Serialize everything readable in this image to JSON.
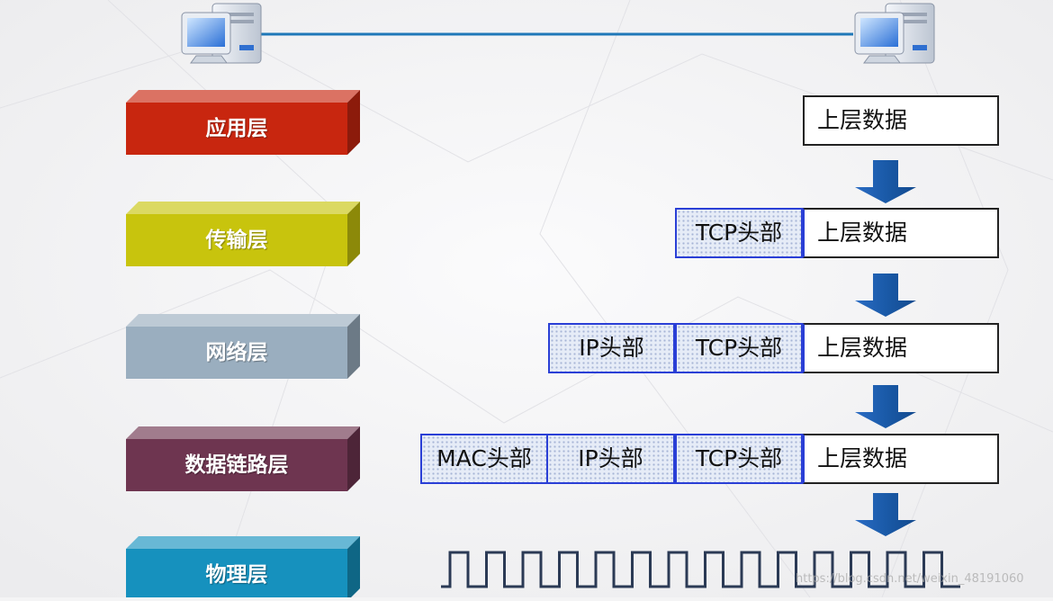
{
  "layers": [
    {
      "label": "应用层",
      "color": "#c8260f"
    },
    {
      "label": "传输层",
      "color": "#c8c40d"
    },
    {
      "label": "网络层",
      "color": "#9aaebf"
    },
    {
      "label": "数据链路层",
      "color": "#6e3550"
    },
    {
      "label": "物理层",
      "color": "#1691be"
    }
  ],
  "packets": {
    "row1": {
      "data": "上层数据"
    },
    "row2": {
      "tcp": "TCP头部",
      "data": "上层数据"
    },
    "row3": {
      "ip": "IP头部",
      "tcp": "TCP头部",
      "data": "上层数据"
    },
    "row4": {
      "mac": "MAC头部",
      "ip": "IP头部",
      "tcp": "TCP头部",
      "data": "上层数据"
    }
  },
  "computers": [
    "computer-icon",
    "computer-icon"
  ],
  "arrow_color": "#1a5aa8",
  "header_border_color": "#2a3fd6",
  "watermark": "https://blog.csdn.net/weixin_48191060"
}
